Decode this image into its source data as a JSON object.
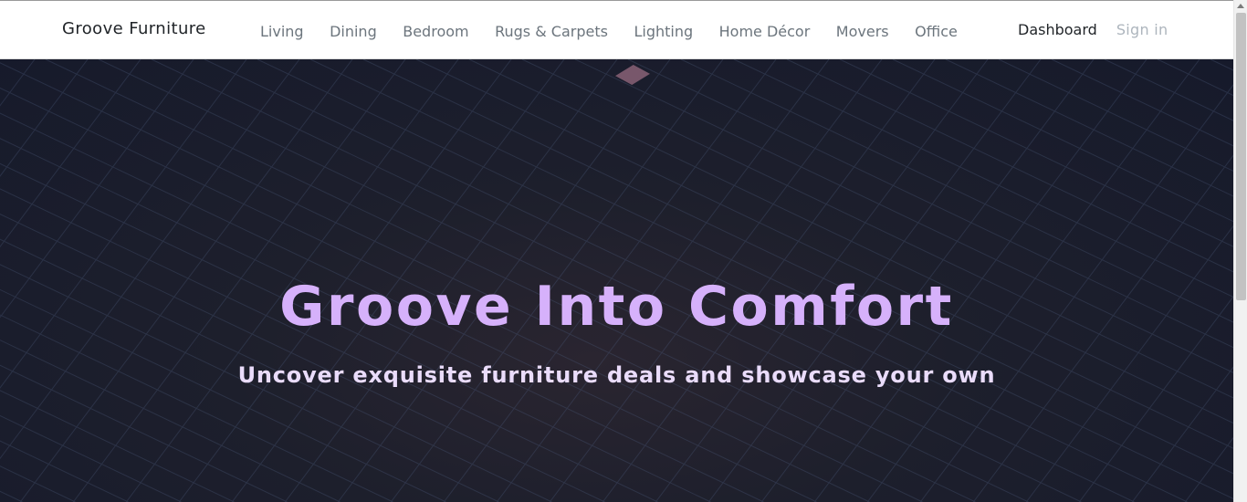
{
  "navbar": {
    "brand": "Groove Furniture",
    "links": [
      "Living",
      "Dining",
      "Bedroom",
      "Rugs & Carpets",
      "Lighting",
      "Home Décor",
      "Movers",
      "Office"
    ],
    "dashboard": "Dashboard",
    "sign_in": "Sign in"
  },
  "hero": {
    "title": "Groove Into Comfort",
    "subtitle": "Uncover exquisite furniture deals and showcase your own"
  },
  "colors": {
    "hero_title": "#d6b1fb",
    "hero_subtitle": "#eadcfb",
    "hero_background": "#161a2b",
    "nav_link": "#6c757d",
    "sign_in": "#adb5bd"
  }
}
